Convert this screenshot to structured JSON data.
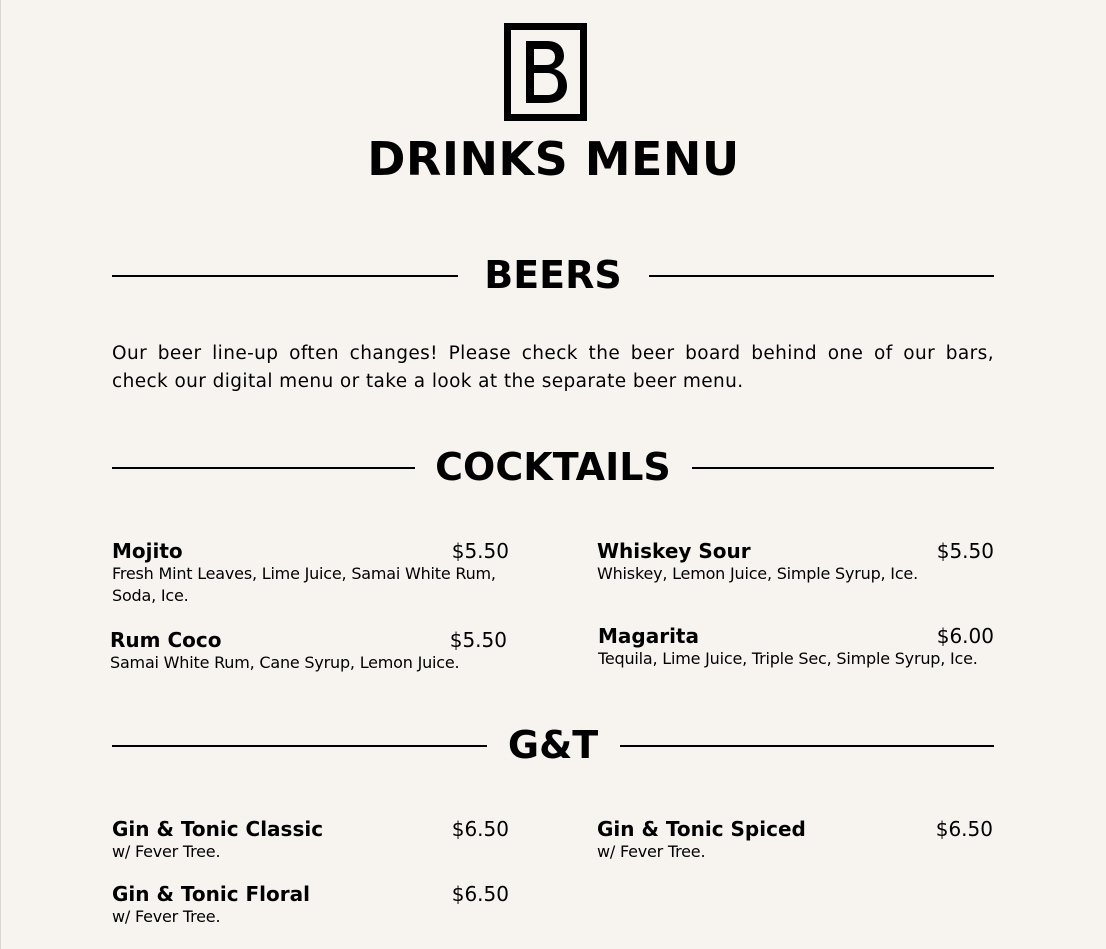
{
  "header": {
    "logo_icon": "b-logo-icon",
    "title": "DRINKS MENU"
  },
  "beers": {
    "heading": "BEERS",
    "text": "Our beer line-up often changes! Please check the beer board behind one of our bars, check our digital menu or take a look at the separate beer menu."
  },
  "cocktails": {
    "heading": "COCKTAILS",
    "items": [
      {
        "name": "Mojito",
        "price": "$5.50",
        "desc": "Fresh Mint Leaves, Lime Juice, Samai White Rum, Soda, Ice."
      },
      {
        "name": "Whiskey Sour",
        "price": "$5.50",
        "desc": "Whiskey, Lemon Juice, Simple Syrup,  Ice."
      },
      {
        "name": "Rum Coco",
        "price": "$5.50",
        "desc": "Samai White Rum, Cane Syrup, Lemon Juice."
      },
      {
        "name": "Magarita",
        "price": "$6.00",
        "desc": "Tequila, Lime Juice, Triple Sec, Simple Syrup, Ice."
      }
    ]
  },
  "gt": {
    "heading": "G&T",
    "items": [
      {
        "name": "Gin & Tonic Classic",
        "price": "$6.50",
        "desc": "w/ Fever Tree."
      },
      {
        "name": "Gin & Tonic Spiced",
        "price": "$6.50",
        "desc": "w/ Fever Tree."
      },
      {
        "name": "Gin & Tonic Floral",
        "price": "$6.50",
        "desc": "w/ Fever Tree."
      }
    ]
  }
}
